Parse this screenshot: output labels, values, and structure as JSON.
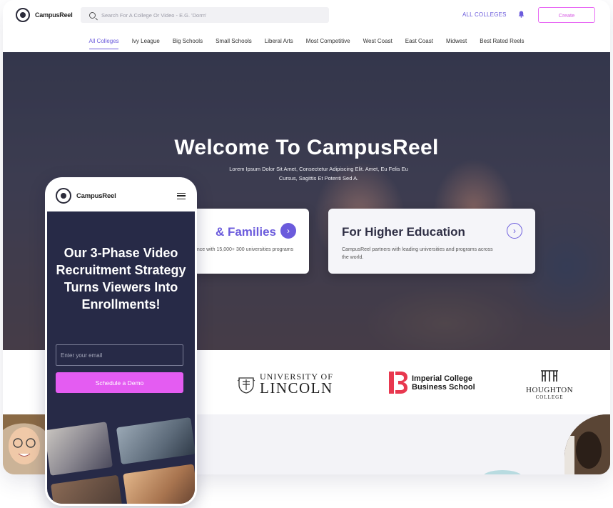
{
  "desktop": {
    "logo_text": "CampusReel",
    "search_placeholder": "Search For A College Or Video - E.G. 'Dorm'",
    "all_colleges_link": "ALL COLLEGES",
    "create_button": "Create",
    "categories": [
      "All Colleges",
      "Ivy League",
      "Big Schools",
      "Small Schools",
      "Liberal Arts",
      "Most Competitive",
      "West Coast",
      "East Coast",
      "Midwest",
      "Best Rated Reels"
    ],
    "hero": {
      "title": "Welcome To CampusReel",
      "subtitle": "Lorem Ipsum Dolor Sit Amet, Consectetur Adipiscing Elit. Amet, Eu Felis Eu Cursus, Sagittis Et Potenti Sed A."
    },
    "cards": [
      {
        "title": "& Families",
        "text": "ence with 15,000+ 300 universities programs"
      },
      {
        "title": "For Higher Education",
        "text": "CampusReel partners with leading universities and programs across the world."
      }
    ],
    "partner_logos": {
      "lincoln_line1": "UNIVERSITY OF",
      "lincoln_line2": "LINCOLN",
      "imperial_line1": "Imperial College",
      "imperial_line2": "Business School",
      "houghton_line1": "HOUGHTON",
      "houghton_line2": "COLLEGE"
    }
  },
  "phone": {
    "logo_text": "CampusReel",
    "headline": "Our 3-Phase Video Recruitment Strategy Turns Viewers Into Enrollments!",
    "email_placeholder": "Enter your email",
    "demo_button": "Schedule a Demo"
  },
  "colors": {
    "accent_purple": "#6b5bdc",
    "accent_pink": "#e45cf2",
    "phone_bg": "#272a47",
    "imperial_red": "#e8384f"
  },
  "icons": [
    "search-icon",
    "bell-icon",
    "chevron-right-icon",
    "hamburger-icon",
    "logo-icon",
    "crest-icon"
  ]
}
